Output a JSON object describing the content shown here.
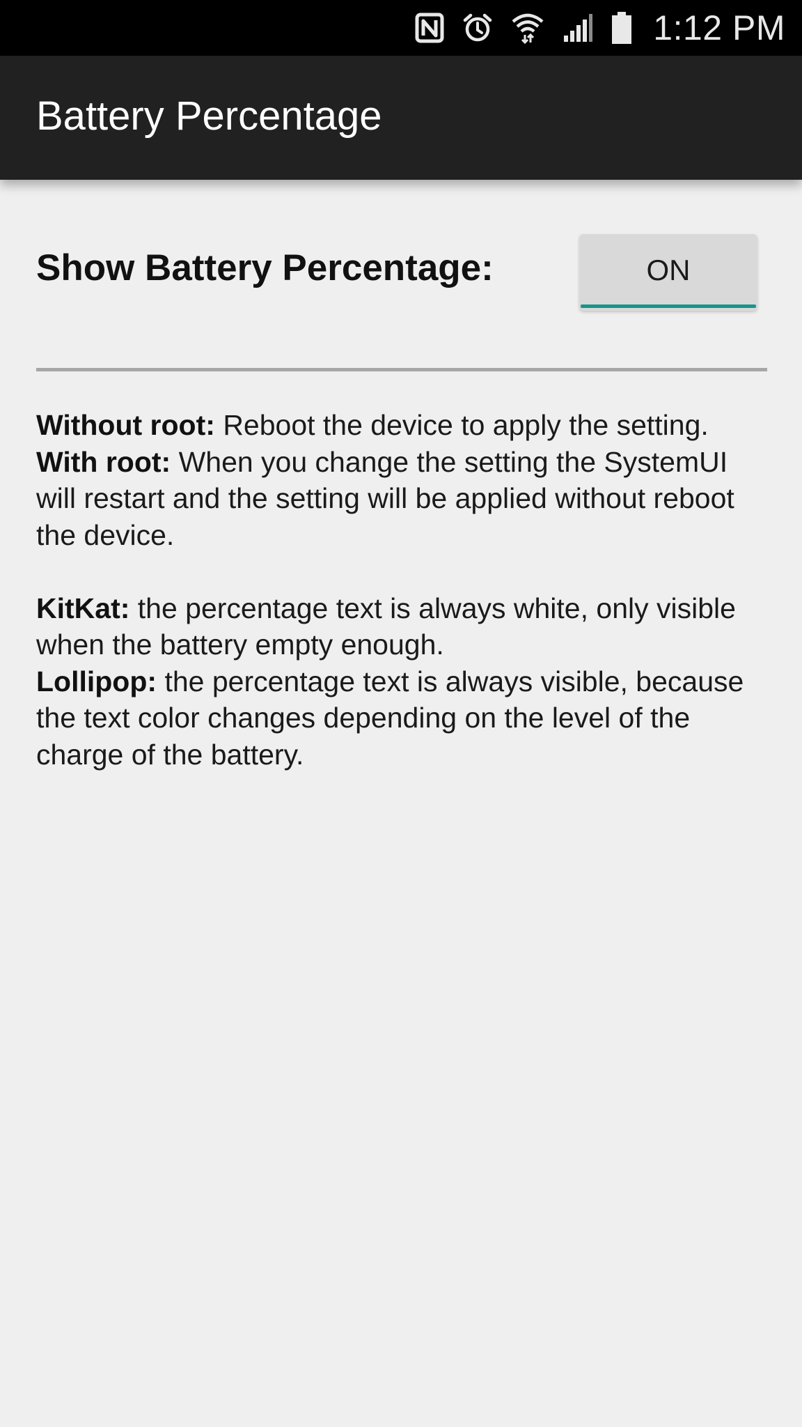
{
  "status_bar": {
    "time": "1:12 PM",
    "icons": [
      "nfc-icon",
      "alarm-icon",
      "wifi-icon",
      "signal-icon",
      "battery-icon"
    ]
  },
  "app_bar": {
    "title": "Battery Percentage"
  },
  "setting": {
    "label": "Show Battery Percentage:",
    "toggle_label": "ON",
    "accent_color": "#17968a"
  },
  "info": {
    "without_root_title": "Without root:",
    "without_root_text": " Reboot the device to apply the setting.",
    "with_root_title": "With root:",
    "with_root_text": " When you change the setting the SystemUI will restart and the setting will be applied without reboot the device.",
    "kitkat_title": "KitKat:",
    "kitkat_text": " the percentage text is always white, only visible when the battery empty enough.",
    "lollipop_title": "Lollipop:",
    "lollipop_text": " the percentage text is always visible, because the text color changes depending on the level of the charge of the battery."
  }
}
